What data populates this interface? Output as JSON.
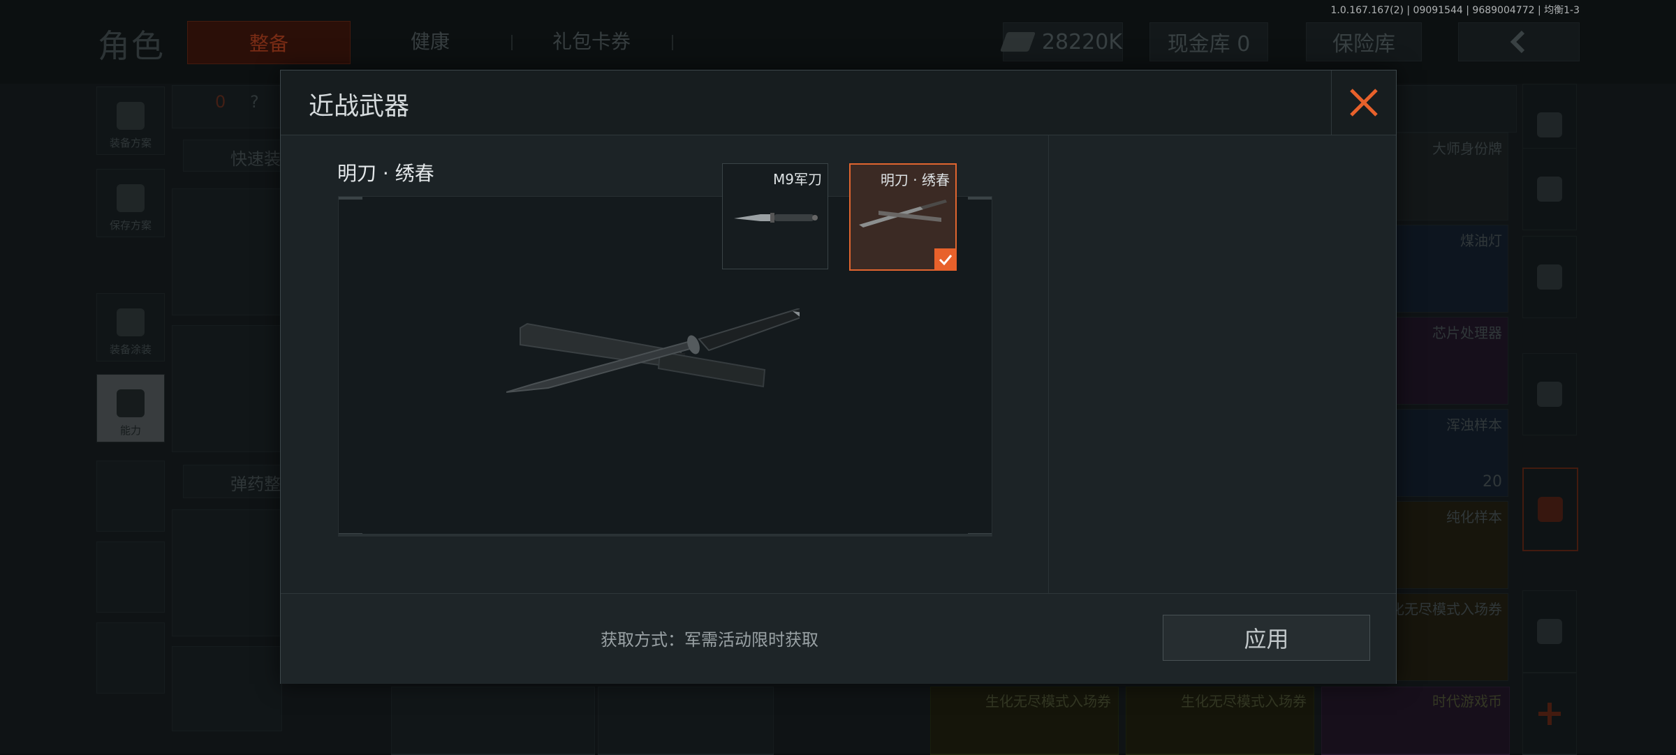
{
  "version": "1.0.167.167(2) | 09091544 | 9689004772 | 均衡1-3",
  "background": {
    "title": "角色",
    "tabs": [
      "整备",
      "健康",
      "礼包卡券"
    ],
    "currency": "28220K",
    "cash": "现金库 0",
    "vault": "保险库",
    "count_badge": "0",
    "count_help": "?",
    "side": [
      "装备方案",
      "保存方案",
      "装备涂装",
      "能力"
    ],
    "quick_label": "快速装",
    "ammo_label": "弹药整",
    "right_items": [
      {
        "name": "大师身份牌",
        "count": ""
      },
      {
        "name": "煤油灯",
        "count": ""
      },
      {
        "name": "芯片处理器",
        "count": ""
      },
      {
        "name": "浑浊样本",
        "count": "20"
      },
      {
        "name": "纯化样本",
        "count": ""
      },
      {
        "name": "化无尽模式入场券",
        "count": ""
      }
    ],
    "bottom_items": [
      "生化无尽模式入场券",
      "生化无尽模式入场券",
      "时代游戏币"
    ]
  },
  "modal": {
    "title": "近战武器",
    "selected_name": "明刀 · 绣春",
    "thumbs": [
      {
        "name": "M9军刀",
        "selected": false
      },
      {
        "name": "明刀 · 绣春",
        "selected": true
      }
    ],
    "acquire_text": "获取方式：军需活动限时获取",
    "apply_label": "应用"
  },
  "colors": {
    "accent": "#e8612b",
    "modal_bg": "#1c2326",
    "preview_bg": "#141a1d"
  }
}
